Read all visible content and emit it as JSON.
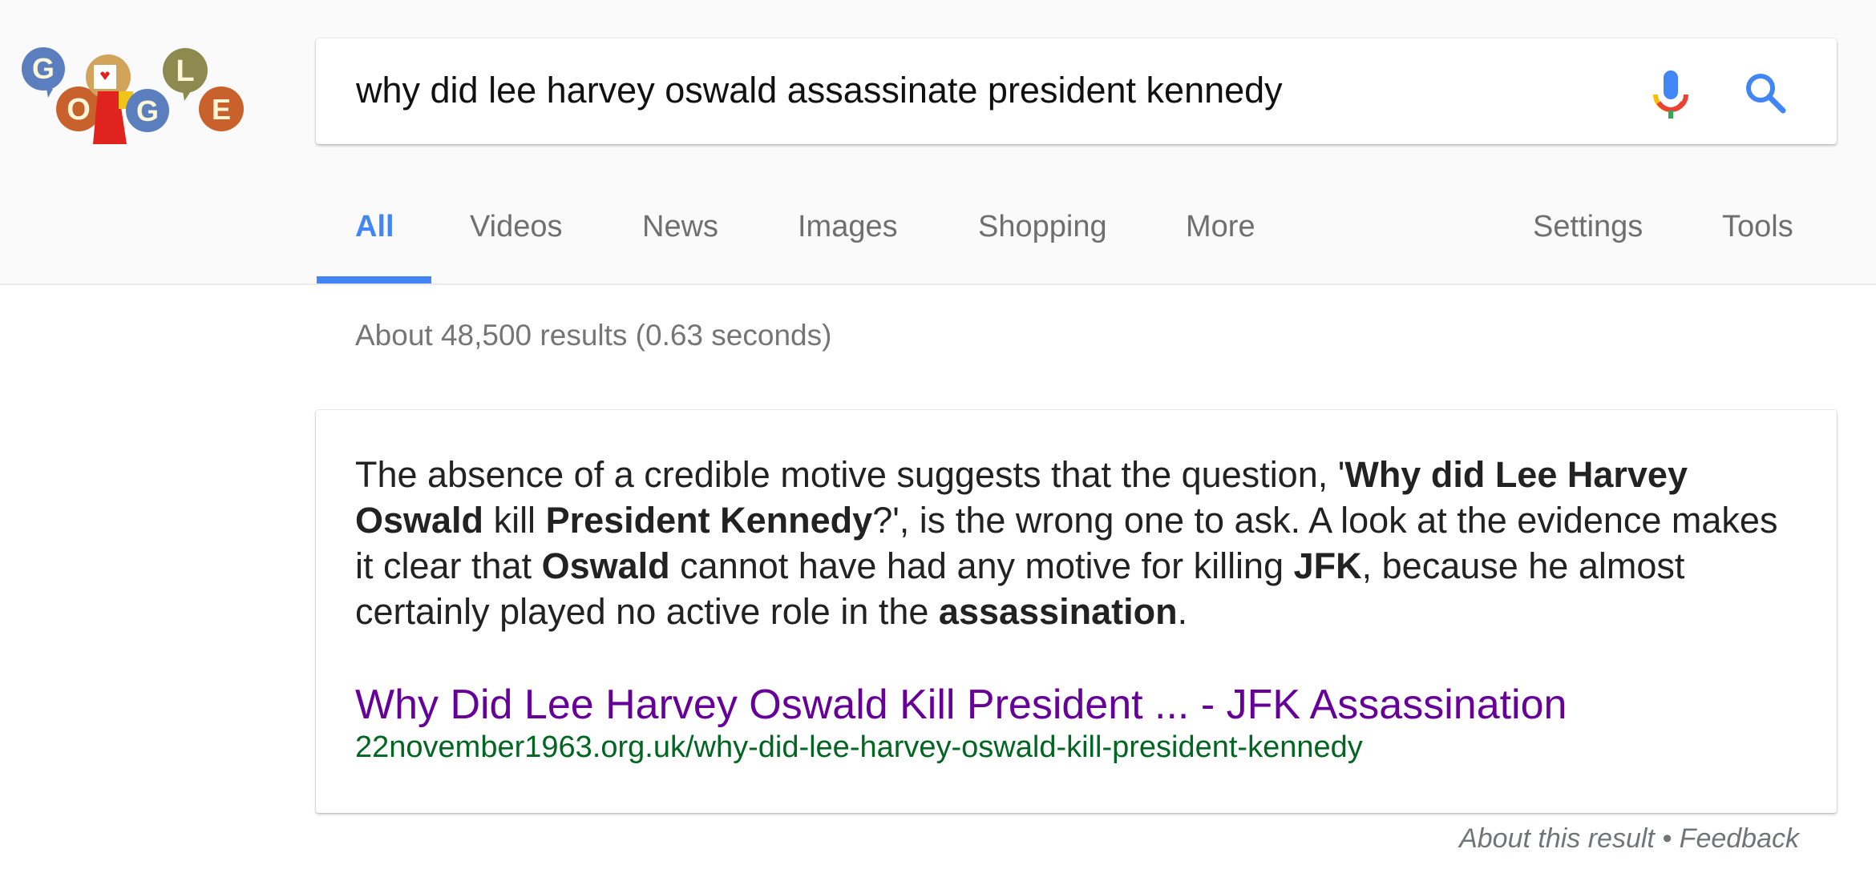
{
  "logo": {
    "letters": [
      "G",
      "O",
      "O",
      "G",
      "L",
      "E"
    ],
    "colors": {
      "blue": "#5b7fbe",
      "orange": "#c8612c",
      "olive": "#8c8a4e",
      "tan": "#d2a35a",
      "red_figure": "#e0231f",
      "letter": "#fdf7d8"
    }
  },
  "search": {
    "query": "why did lee harvey oswald assassinate president kennedy",
    "mic_icon": "microphone-icon",
    "search_icon": "search-icon"
  },
  "tabs": [
    {
      "label": "All",
      "active": true
    },
    {
      "label": "Videos",
      "active": false
    },
    {
      "label": "News",
      "active": false
    },
    {
      "label": "Images",
      "active": false
    },
    {
      "label": "Shopping",
      "active": false
    },
    {
      "label": "More",
      "active": false
    }
  ],
  "tools": [
    {
      "label": "Settings"
    },
    {
      "label": "Tools"
    }
  ],
  "result_stats": "About 48,500 results (0.63 seconds)",
  "featured_snippet": {
    "segments": [
      {
        "text": "The absence of a credible motive suggests that the question, '",
        "bold": false
      },
      {
        "text": "Why did Lee Harvey Oswald",
        "bold": true
      },
      {
        "text": " kill ",
        "bold": false
      },
      {
        "text": "President Kennedy",
        "bold": true
      },
      {
        "text": "?', is the wrong one to ask. A look at the evidence makes it clear that ",
        "bold": false
      },
      {
        "text": "Oswald",
        "bold": true
      },
      {
        "text": " cannot have had any motive for killing ",
        "bold": false
      },
      {
        "text": "JFK",
        "bold": true
      },
      {
        "text": ", because he almost certainly played no active role in the ",
        "bold": false
      },
      {
        "text": "assassination",
        "bold": true
      },
      {
        "text": ".",
        "bold": false
      }
    ],
    "title": "Why Did Lee Harvey Oswald Kill President ... - JFK Assassination",
    "url": "22november1963.org.uk/why-did-lee-harvey-oswald-kill-president-kennedy"
  },
  "footer": {
    "about": "About this result",
    "separator": " • ",
    "feedback": "Feedback"
  },
  "colors": {
    "accent": "#4285f4",
    "visited_link": "#660099",
    "url_green": "#006621",
    "muted_text": "#757575"
  }
}
